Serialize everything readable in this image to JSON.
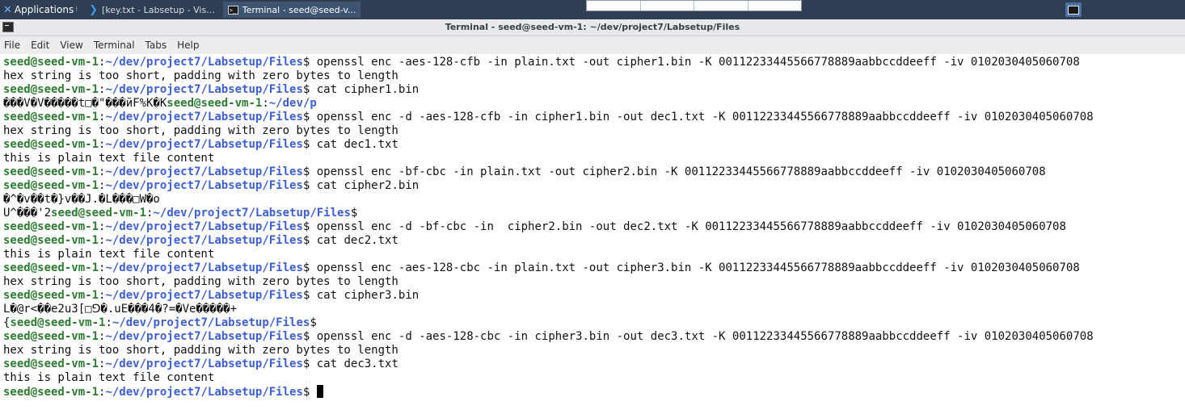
{
  "taskbar": {
    "applications_label": "Applications",
    "tasks": [
      {
        "label": "[key.txt - Labsetup - Vis...",
        "icon": "vscode-icon",
        "active": false
      },
      {
        "label": "Terminal - seed@seed-v...",
        "icon": "terminal-icon",
        "active": true
      }
    ]
  },
  "window": {
    "title": "Terminal - seed@seed-vm-1: ~/dev/project7/Labsetup/Files"
  },
  "menu": [
    "File",
    "Edit",
    "View",
    "Terminal",
    "Tabs",
    "Help"
  ],
  "colors": {
    "prompt_user": "#2e7d32",
    "prompt_path": "#3d5fd6",
    "panel": "#2f3e52"
  },
  "terminal": {
    "lines": [
      {
        "user": "seed@seed-vm-1",
        "path": "~/dev/project7/Labsetup/Files",
        "cmd": " openssl enc -aes-128-cfb -in plain.txt -out cipher1.bin -K 00112233445566778889aabbccddeeff -iv 0102030405060708"
      },
      {
        "text": "hex string is too short, padding with zero bytes to length"
      },
      {
        "user": "seed@seed-vm-1",
        "path": "~/dev/project7/Labsetup/Files",
        "cmd": " cat cipher1.bin"
      },
      {
        "text": "���V�V�����t□�\"���йF%K�K",
        "user_tail": "seed@seed-vm-1",
        "path_tail": "~/dev/p"
      },
      {
        "user": "seed@seed-vm-1",
        "path": "~/dev/project7/Labsetup/Files",
        "cmd": " openssl enc -d -aes-128-cfb -in cipher1.bin -out dec1.txt -K 00112233445566778889aabbccddeeff -iv 0102030405060708"
      },
      {
        "text": "hex string is too short, padding with zero bytes to length"
      },
      {
        "user": "seed@seed-vm-1",
        "path": "~/dev/project7/Labsetup/Files",
        "cmd": " cat dec1.txt"
      },
      {
        "text": "this is plain text file content"
      },
      {
        "user": "seed@seed-vm-1",
        "path": "~/dev/project7/Labsetup/Files",
        "cmd": " openssl enc -bf-cbc -in plain.txt -out cipher2.bin -K 00112233445566778889aabbccddeeff -iv 0102030405060708"
      },
      {
        "user": "seed@seed-vm-1",
        "path": "~/dev/project7/Labsetup/Files",
        "cmd": " cat cipher2.bin"
      },
      {
        "text": "�^�v��t�}v��J.�L���□W�o"
      },
      {
        "text": "U^���'2",
        "user_tail": "seed@seed-vm-1",
        "path_tail": "~/dev/project7/Labsetup/Files"
      },
      {
        "user": "seed@seed-vm-1",
        "path": "~/dev/project7/Labsetup/Files",
        "cmd": " openssl enc -d -bf-cbc -in  cipher2.bin -out dec2.txt -K 00112233445566778889aabbccddeeff -iv 0102030405060708"
      },
      {
        "user": "seed@seed-vm-1",
        "path": "~/dev/project7/Labsetup/Files",
        "cmd": " cat dec2.txt"
      },
      {
        "text": "this is plain text file content"
      },
      {
        "user": "seed@seed-vm-1",
        "path": "~/dev/project7/Labsetup/Files",
        "cmd": " openssl enc -aes-128-cbc -in plain.txt -out cipher3.bin -K 00112233445566778889aabbccddeeff -iv 0102030405060708"
      },
      {
        "text": "hex string is too short, padding with zero bytes to length"
      },
      {
        "user": "seed@seed-vm-1",
        "path": "~/dev/project7/Labsetup/Files",
        "cmd": " cat cipher3.bin"
      },
      {
        "text": "L�@r<��e2u3[□⅁�.uE���4�?=�Ve�����+"
      },
      {
        "text": "{",
        "user_tail": "seed@seed-vm-1",
        "path_tail": "~/dev/project7/Labsetup/Files"
      },
      {
        "user": "seed@seed-vm-1",
        "path": "~/dev/project7/Labsetup/Files",
        "cmd": " openssl enc -d -aes-128-cbc -in cipher3.bin -out dec3.txt -K 00112233445566778889aabbccddeeff -iv 0102030405060708"
      },
      {
        "text": "hex string is too short, padding with zero bytes to length"
      },
      {
        "user": "seed@seed-vm-1",
        "path": "~/dev/project7/Labsetup/Files",
        "cmd": " cat dec3.txt"
      },
      {
        "text": "this is plain text file content"
      },
      {
        "user": "seed@seed-vm-1",
        "path": "~/dev/project7/Labsetup/Files",
        "cmd": " ",
        "cursor": true
      }
    ]
  }
}
